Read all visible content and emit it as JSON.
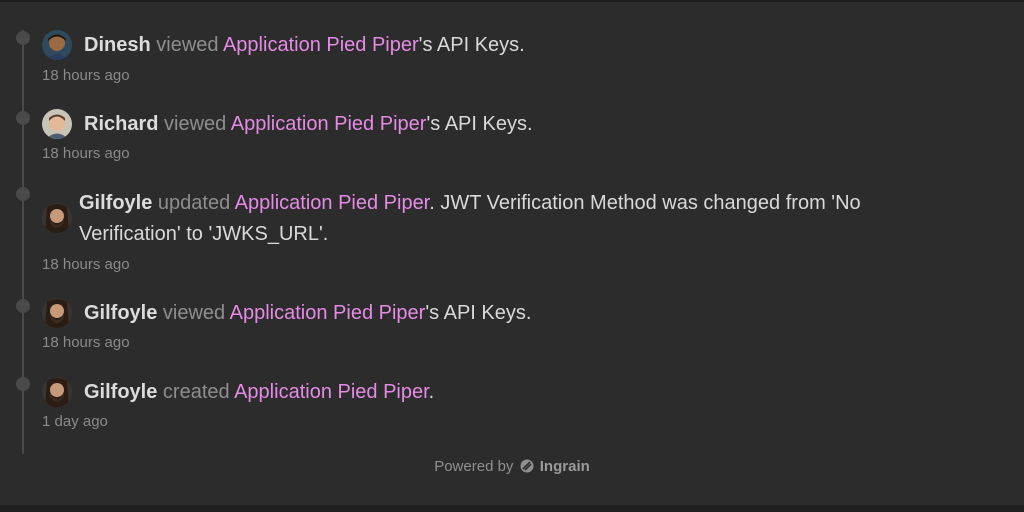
{
  "activity": [
    {
      "user": "Dinesh",
      "verb": "viewed",
      "target": "Application Pied Piper",
      "suffix": "'s API Keys.",
      "time": "18 hours ago"
    },
    {
      "user": "Richard",
      "verb": "viewed",
      "target": "Application Pied Piper",
      "suffix": "'s API Keys.",
      "time": "18 hours ago"
    },
    {
      "user": "Gilfoyle",
      "verb": "updated",
      "target": "Application Pied Piper",
      "suffix": ". JWT Verification Method was changed from 'No Verification' to 'JWKS_URL'.",
      "time": "18 hours ago"
    },
    {
      "user": "Gilfoyle",
      "verb": "viewed",
      "target": "Application Pied Piper",
      "suffix": "'s API Keys.",
      "time": "18 hours ago"
    },
    {
      "user": "Gilfoyle",
      "verb": "created",
      "target": "Application Pied Piper",
      "suffix": ".",
      "time": "1 day ago"
    }
  ],
  "footer": {
    "powered_by": "Powered by",
    "brand": "Ingrain",
    "brand_icon": "ingrain-logo-icon"
  },
  "colors": {
    "background": "#2c2c2c",
    "link": "#e58be6",
    "verb": "#8e8e8e",
    "user": "#dcdcdc"
  }
}
